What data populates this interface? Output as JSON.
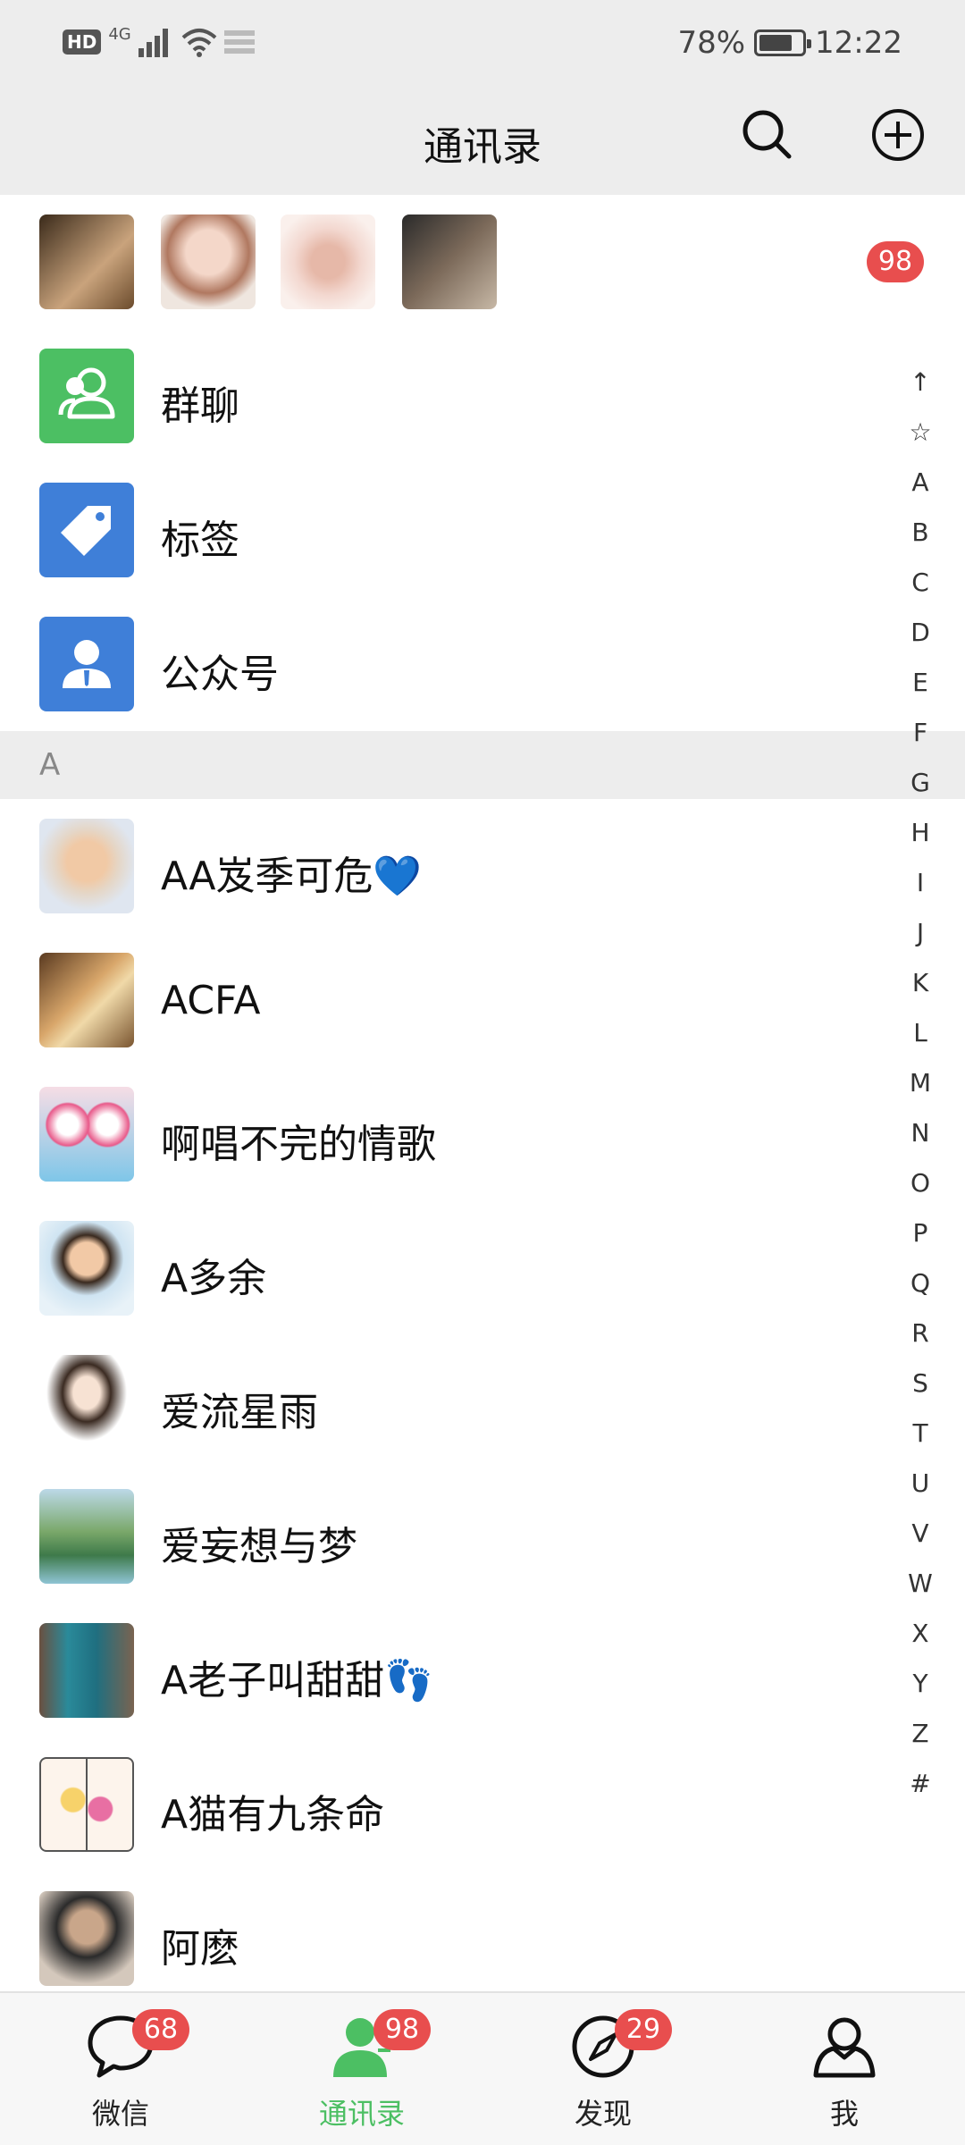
{
  "status_bar": {
    "hd": "HD",
    "network": "4G",
    "battery_percent": "78%",
    "battery_level": 0.78,
    "time": "12:22"
  },
  "nav": {
    "title": "通讯录"
  },
  "top_badge": "98",
  "functions": [
    {
      "label": "群聊",
      "icon": "group-chat-icon",
      "color": "#4cbf63"
    },
    {
      "label": "标签",
      "icon": "tag-icon",
      "color": "#3f7fd8"
    },
    {
      "label": "公众号",
      "icon": "official-account-icon",
      "color": "#3f7fd8"
    }
  ],
  "section": {
    "letter": "A"
  },
  "contacts": [
    {
      "name": "AA岌季可危💙"
    },
    {
      "name": "ACFA"
    },
    {
      "name": "啊唱不完的情歌"
    },
    {
      "name": "A多余"
    },
    {
      "name": "爱流星雨"
    },
    {
      "name": "爱妄想与梦"
    },
    {
      "name": "A老子叫甜甜👣"
    },
    {
      "name": "A猫有九条命"
    },
    {
      "name": "阿麽"
    }
  ],
  "alphabet": [
    "↑",
    "☆",
    "A",
    "B",
    "C",
    "D",
    "E",
    "F",
    "G",
    "H",
    "I",
    "J",
    "K",
    "L",
    "M",
    "N",
    "O",
    "P",
    "Q",
    "R",
    "S",
    "T",
    "U",
    "V",
    "W",
    "X",
    "Y",
    "Z",
    "#"
  ],
  "tabs": [
    {
      "label": "微信",
      "badge": "68",
      "icon": "chat-bubble-icon"
    },
    {
      "label": "通讯录",
      "badge": "98",
      "icon": "contacts-icon",
      "active": true
    },
    {
      "label": "发现",
      "badge": "29",
      "icon": "compass-icon"
    },
    {
      "label": "我",
      "badge": "",
      "icon": "person-icon"
    }
  ],
  "colors": {
    "accent_green": "#4cbf63",
    "badge_red": "#e84e4e",
    "header_bg": "#ededed"
  }
}
